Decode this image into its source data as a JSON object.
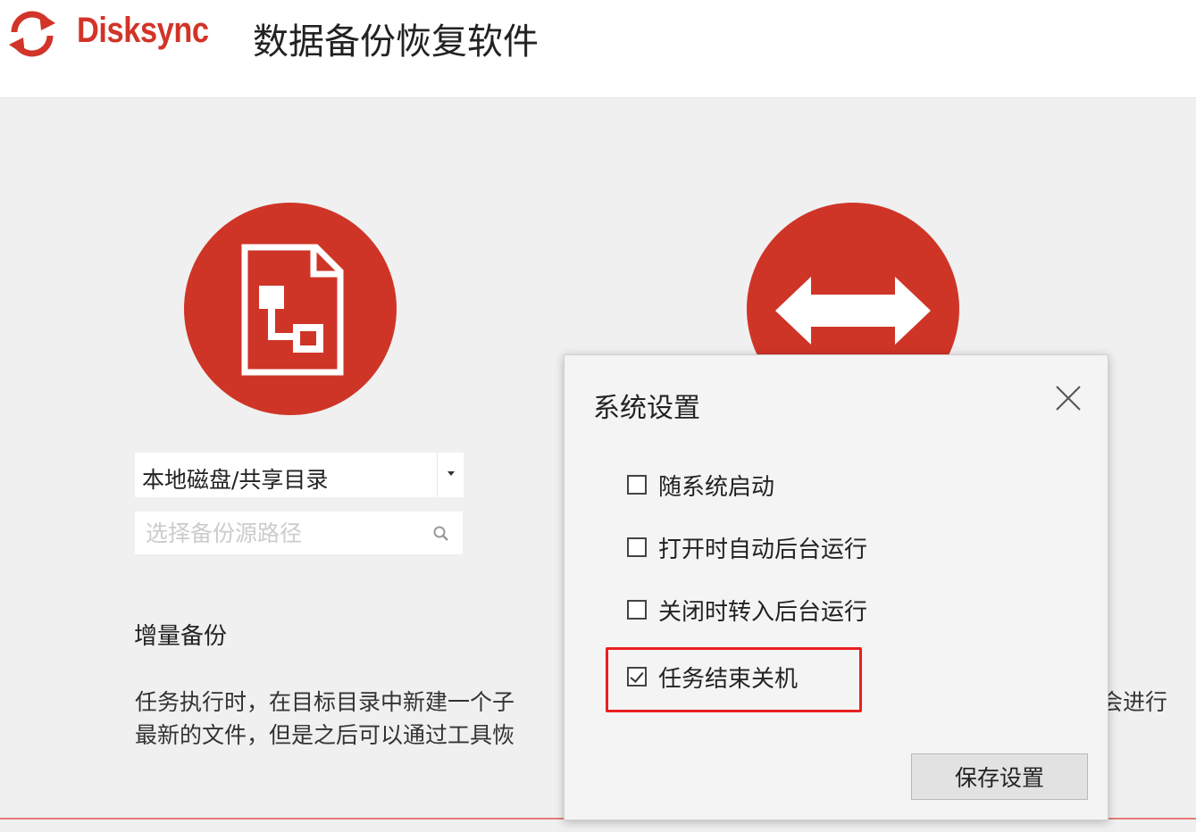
{
  "header": {
    "brand": "Disksync",
    "product_name": "数据备份恢复软件",
    "logo_icon": "sync-arrows-icon",
    "brand_color": "#d23428"
  },
  "main": {
    "accent_color": "#cf3527",
    "source_icon": "file-tree-icon",
    "sync_icon": "double-arrow-icon",
    "source_type_selected": "本地磁盘/共享目录",
    "path_placeholder": "选择备份源路径",
    "search_icon": "search-icon",
    "mode_title": "增量备份",
    "description_line1": "任务执行时，在目标目录中新建一个子",
    "description_line2": "最新的文件，但是之后可以通过工具恢",
    "description_right_fragment": "会进行"
  },
  "dialog": {
    "title": "系统设置",
    "close_icon": "close-icon",
    "options": [
      {
        "label": "随系统启动",
        "checked": false
      },
      {
        "label": "打开时自动后台运行",
        "checked": false
      },
      {
        "label": "关闭时转入后台运行",
        "checked": false
      },
      {
        "label": "任务结束关机",
        "checked": true
      }
    ],
    "highlight_color": "#e8201f",
    "save_label": "保存设置"
  }
}
